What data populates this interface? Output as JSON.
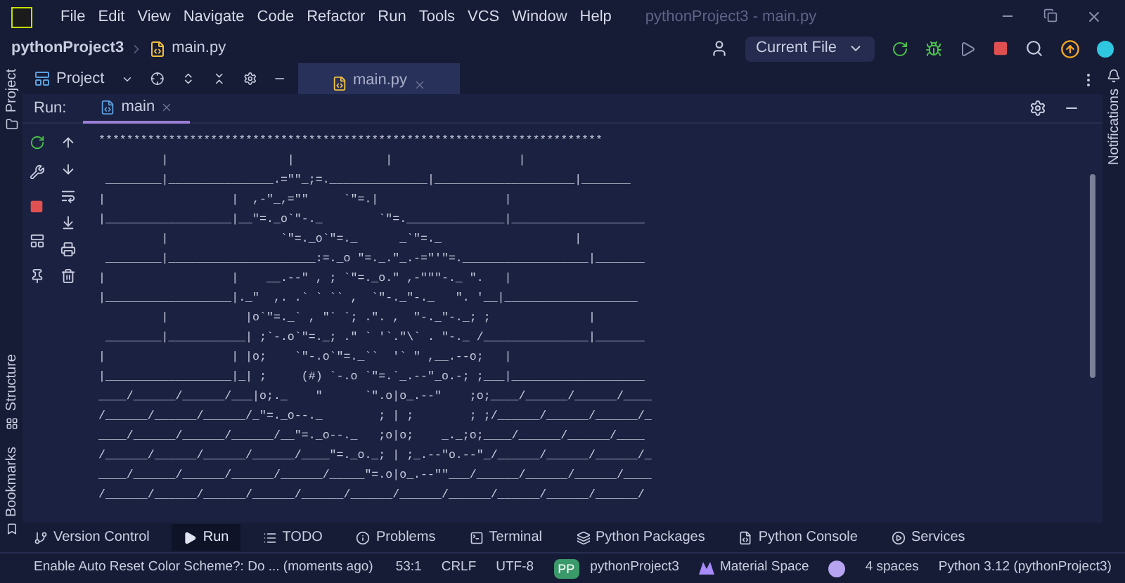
{
  "menu_bar": {
    "items": [
      "File",
      "Edit",
      "View",
      "Navigate",
      "Code",
      "Refactor",
      "Run",
      "Tools",
      "VCS",
      "Window",
      "Help"
    ],
    "title": "pythonProject3 - main.py"
  },
  "nav_bar": {
    "breadcrumb": [
      "pythonProject3",
      "main.py"
    ],
    "run_config": "Current File"
  },
  "left_stripe": {
    "top": [
      "Project"
    ],
    "bottom": [
      "Structure",
      "Bookmarks"
    ]
  },
  "right_stripe": [
    "Notifications"
  ],
  "project_toolbar": {
    "label": "Project"
  },
  "editor_tabs": [
    {
      "label": "main.py",
      "selected": true
    }
  ],
  "run_panel": {
    "label": "Run:",
    "tabs": [
      {
        "label": "main",
        "selected": true
      }
    ],
    "output": [
      "************************************************************************",
      "         |                 |             |                  |",
      " ________|_______________.=\"\"_;=.______________|____________________|_______",
      "|                  |  ,-\"_,=\"\"     `\"=.|                  |",
      "|__________________|__\"=._o`\"-._        `\"=.______________|___________________",
      "         |                `\"=._o`\"=._      _`\"=._                   |",
      " ________|_____________________:=._o \"=._.\"_.-=\"'\"=.__________________|_______",
      "|                  |    __.--\" , ; `\"=._o.\" ,-\"\"\"-._ \".   |",
      "|__________________|._\"  ,. .` ` `` ,  `\"-._\"-._   \". '__|___________________",
      "         |           |o`\"=._` , \"` `; .\". ,  \"-._\"-._; ;              |",
      " ________|___________| ;`-.o`\"=._; .\" ` '`.\"\\` . \"-._ /_______________|_______",
      "|                  | |o;    `\"-.o`\"=._``  '` \" ,__.--o;   |",
      "|__________________|_| ;     (#) `-.o `\"=.`_.--\"_o.-; ;___|___________________",
      "____/______/______/___|o;._    \"      `\".o|o_.--\"    ;o;____/______/______/____",
      "/______/______/______/_\"=._o--._        ; | ;        ; ;/______/______/______/_",
      "____/______/______/______/__\"=._o--._   ;o|o;    _._;o;____/______/______/____",
      "/______/______/______/______/____\"=._o._; | ;_.--\"o.--\"_/______/______/______/_",
      "____/______/______/______/______/_____\"=.o|o_.--\"\"___/______/______/______/____",
      "/______/______/______/______/______/______/______/______/______/______/______/"
    ]
  },
  "tool_windows": [
    {
      "kind": "vcs",
      "label": "Version Control",
      "selected": false
    },
    {
      "kind": "run",
      "label": "Run",
      "selected": true
    },
    {
      "kind": "todo",
      "label": "TODO",
      "selected": false
    },
    {
      "kind": "problems",
      "label": "Problems",
      "selected": false
    },
    {
      "kind": "terminal",
      "label": "Terminal",
      "selected": false
    },
    {
      "kind": "packages",
      "label": "Python Packages",
      "selected": false
    },
    {
      "kind": "console",
      "label": "Python Console",
      "selected": false
    },
    {
      "kind": "services",
      "label": "Services",
      "selected": false
    }
  ],
  "status_bar": {
    "message": "Enable Auto Reset Color Scheme?: Do ... (moments ago)",
    "items": [
      {
        "kind": "text",
        "label": "53:1"
      },
      {
        "kind": "text",
        "label": "CRLF"
      },
      {
        "kind": "text",
        "label": "UTF-8"
      },
      {
        "kind": "project",
        "badge": "PP",
        "label": "pythonProject3"
      },
      {
        "kind": "theme",
        "label": "Material Space"
      },
      {
        "kind": "indent",
        "label": "4 spaces"
      },
      {
        "kind": "text",
        "label": "Python 3.12 (pythonProject3)"
      }
    ]
  }
}
